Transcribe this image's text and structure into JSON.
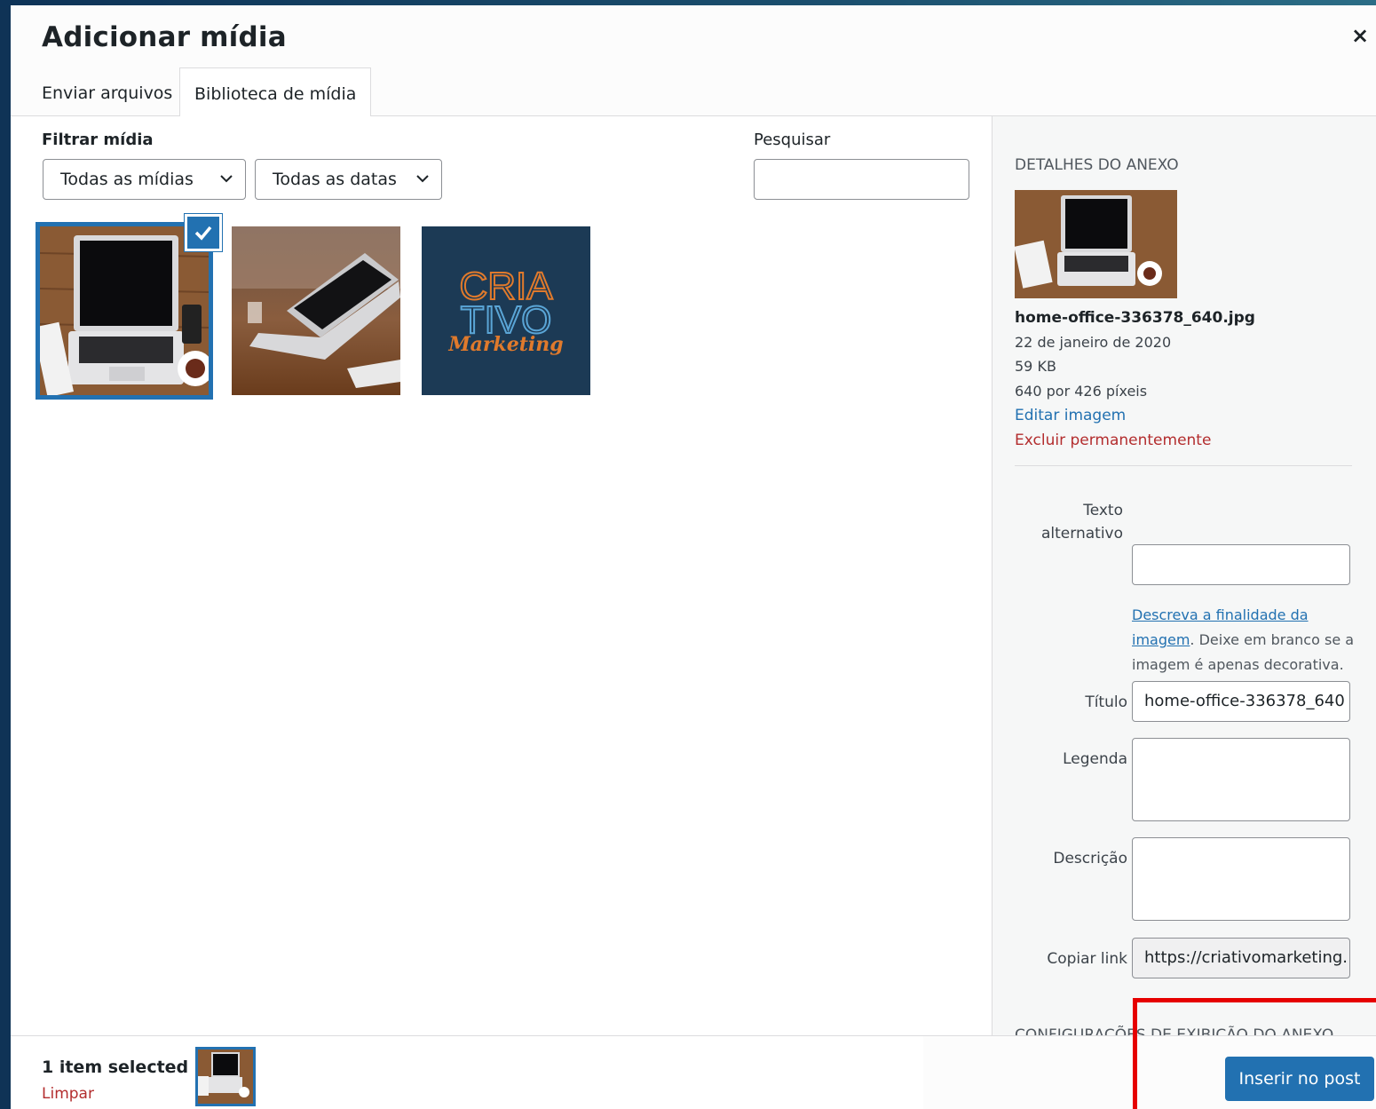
{
  "modal": {
    "title": "Adicionar mídia",
    "close_glyph": "×"
  },
  "tabs": [
    {
      "label": "Enviar arquivos",
      "active": false
    },
    {
      "label": "Biblioteca de mídia",
      "active": true
    }
  ],
  "filters": {
    "label": "Filtrar mídia",
    "type_select": "Todas as mídias",
    "date_select": "Todas as datas",
    "search_label": "Pesquisar",
    "search_value": ""
  },
  "library": {
    "items": [
      {
        "kind": "laptop-desk",
        "selected": true
      },
      {
        "kind": "laptop-table",
        "selected": false
      },
      {
        "kind": "logo",
        "selected": false
      }
    ],
    "logo_text": {
      "line1": "CRIA",
      "line2": "TIVO",
      "line3": "Marketing"
    }
  },
  "details": {
    "heading": "DETALHES DO ANEXO",
    "filename": "home-office-336378_640.jpg",
    "date": "22 de janeiro de 2020",
    "size": "59 KB",
    "dimensions": "640 por 426 píxeis",
    "edit_link": "Editar imagem",
    "delete_link": "Excluir permanentemente",
    "alt_label_1": "Texto",
    "alt_label_2": "alternativo",
    "alt_value": "",
    "alt_help_link_1": "Descreva a finalidade da",
    "alt_help_link_2": "imagem",
    "alt_help_rest": ". Deixe em branco se a imagem é apenas decorativa.",
    "title_label": "Título",
    "title_value": "home-office-336378_640",
    "caption_label": "Legenda",
    "caption_value": "",
    "description_label": "Descrição",
    "description_value": "",
    "copy_label": "Copiar link",
    "copy_value": "https://criativomarketing.",
    "display_heading": "CONFIGURAÇÕES DE EXIBIÇÃO DO ANEXO"
  },
  "footer": {
    "count": "1 item selected",
    "clear": "Limpar",
    "insert": "Inserir no post"
  },
  "colors": {
    "accent": "#2271b1",
    "danger": "#b32d2e",
    "highlight": "#e60000"
  }
}
